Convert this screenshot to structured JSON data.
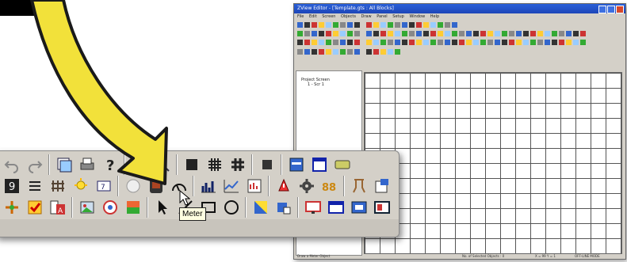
{
  "window": {
    "title": "ZView Editor - [Template.gts : All Blocks]",
    "menu": [
      "File",
      "Edit",
      "Screen",
      "Objects",
      "Draw",
      "Panel",
      "Setup",
      "Window",
      "Help"
    ]
  },
  "tree": {
    "root_label": "Project Screen",
    "child_label": "1 - Scr 1"
  },
  "status": {
    "left": "Draw a Meter Object",
    "mid": "No. of Selected Objects : 0",
    "pos": "X = 99 Y = 1",
    "mode": "OFF-LINE MODE"
  },
  "tooltip": {
    "text": "Meter"
  },
  "toolbar": {
    "row1": [
      "undo-icon",
      "redo-icon",
      "screen-copy-icon",
      "print-icon",
      "help-icon",
      "zoom-in-icon",
      "zoom-out-icon",
      "grid-small-icon",
      "grid-medium-icon",
      "grid-large-icon",
      "fill-icon",
      "layer-icon",
      "window-icon",
      "display-icon"
    ],
    "row2": [
      "numeric-icon",
      "list-icon",
      "pipe-icon",
      "lamp-icon",
      "message-icon",
      "circle-icon",
      "monitor-icon",
      "meter-icon",
      "bar-graph-icon",
      "trend-icon",
      "chart-icon",
      "alarm-icon",
      "gear-icon",
      "counter-icon",
      "recipe-icon",
      "input-icon",
      "io-icon"
    ],
    "row3": [
      "cross-icon",
      "check-icon",
      "text-icon",
      "picture-icon",
      "symbol-icon",
      "gradient-icon",
      "pointer-icon",
      "line-icon",
      "rectangle-icon",
      "ellipse-icon",
      "polygon-icon",
      "shape-icon",
      "screen-icon",
      "window-open-icon",
      "popup-icon",
      "frame-icon"
    ]
  },
  "colors": {
    "arrow": "#f2e13a",
    "arrow_outline": "#1a1a1a",
    "title_bar": "#2050c8",
    "tooltip_bg": "#ffffe1"
  }
}
